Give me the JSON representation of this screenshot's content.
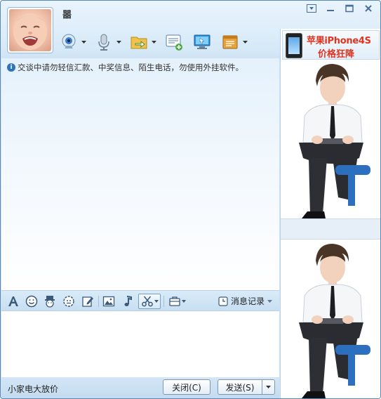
{
  "contact": {
    "name": "噐"
  },
  "window_controls": [
    "menu-arrow",
    "minimize",
    "maximize",
    "close"
  ],
  "toolbar": [
    "webcam",
    "microphone",
    "file-transfer",
    "sms",
    "remote-assist",
    "app-box"
  ],
  "chat": {
    "notice": "交谈中请勿轻信汇款、中奖信息、陌生电话，勿使用外挂软件。"
  },
  "input_toolbar": {
    "tools": [
      "font",
      "emoticon",
      "magic-face",
      "shake",
      "doodle",
      "image",
      "music",
      "screenshot",
      "more-apps"
    ],
    "history_label": "消息记录"
  },
  "bottom": {
    "ad_text": "小家电大放价",
    "close_button": "关闭(C)",
    "send_button": "发送(S)"
  },
  "ad_banner": {
    "line1": "苹果iPhone4S",
    "line2": "价格狂降"
  },
  "colors": {
    "accent": "#2d73c2",
    "ad_red": "#e2331f",
    "border": "#5b87b6"
  }
}
